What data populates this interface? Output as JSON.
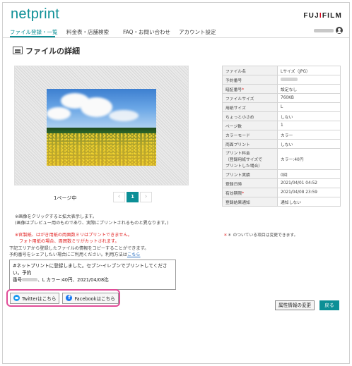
{
  "header": {
    "logo": "netprint",
    "brand_prefix": "FUJ",
    "brand_i": "I",
    "brand_suffix": "FILM"
  },
  "nav": {
    "tabs": [
      {
        "label": "ファイル登録・一覧",
        "active": true
      },
      {
        "label": "料金表・店舗検索",
        "active": false
      },
      {
        "label": "FAQ・お問い合わせ",
        "active": false
      },
      {
        "label": "アカウント設定",
        "active": false
      }
    ]
  },
  "page": {
    "title": "ファイルの詳細"
  },
  "preview": {
    "page_label": "1ページ中",
    "current_page": "1",
    "prev_symbol": "‹",
    "next_symbol": "›"
  },
  "notes": {
    "click_enlarge": "※画像をクリックすると拡大表示します。",
    "preview_note": "(画像はプレビュー用のものであり、実際にプリントされるものと異なります。)",
    "warn1": "※官製紙、はがき用紙の両面数ミリはプリントできません。",
    "warn2": "フォト用紙の場合、周囲数ミリがカットされます。",
    "copy_info": "下記エリアから登録したファイルの情報をコピーすることができます。",
    "share_info": "予約番号をシェアしたい場合にご利用ください。利用方法は",
    "share_link": "こちら"
  },
  "share": {
    "text_line1": "#ネットプリントに登録しました。セブン‐イレブンでプリントしてください。予約",
    "text_line2_prefix": "番号",
    "text_line2_suffix": "、L カラー:40円、2021/04/08迄",
    "twitter_label": "Twitterはこちら",
    "facebook_label": "Facebookはこちら"
  },
  "details": {
    "rows": [
      {
        "key": "ファイル名",
        "value": "Lサイズ（JPG）"
      },
      {
        "key": "予約番号",
        "value": ""
      },
      {
        "key": "暗証番号",
        "required": true,
        "value": "設定なし"
      },
      {
        "key": "ファイルサイズ",
        "value": "760KB"
      },
      {
        "key": "用紙サイズ",
        "value": "L"
      },
      {
        "key": "ちょっと小さめ",
        "value": "しない"
      },
      {
        "key": "ページ数",
        "value": "1"
      },
      {
        "key": "カラーモード",
        "value": "カラー"
      },
      {
        "key": "両面プリント",
        "value": "しない"
      },
      {
        "key": "プリント料金\n（登録用紙サイズで\nプリントした場合）",
        "value": "カラー:40円"
      },
      {
        "key": "プリント実績",
        "value": "0回"
      },
      {
        "key": "登録日時",
        "value": "2021/04/01 04:52"
      },
      {
        "key": "有効期限",
        "required": true,
        "value": "2021/04/08 23:59"
      },
      {
        "key": "登録結果通知",
        "value": "通知しない"
      }
    ],
    "note": "＊ のついている項目は変更できます。"
  },
  "buttons": {
    "attr_change": "属性情報の変更",
    "back": "戻る"
  },
  "colors": {
    "accent": "#0c8f96",
    "highlight": "#e14c98",
    "warning": "#e11d1d"
  }
}
